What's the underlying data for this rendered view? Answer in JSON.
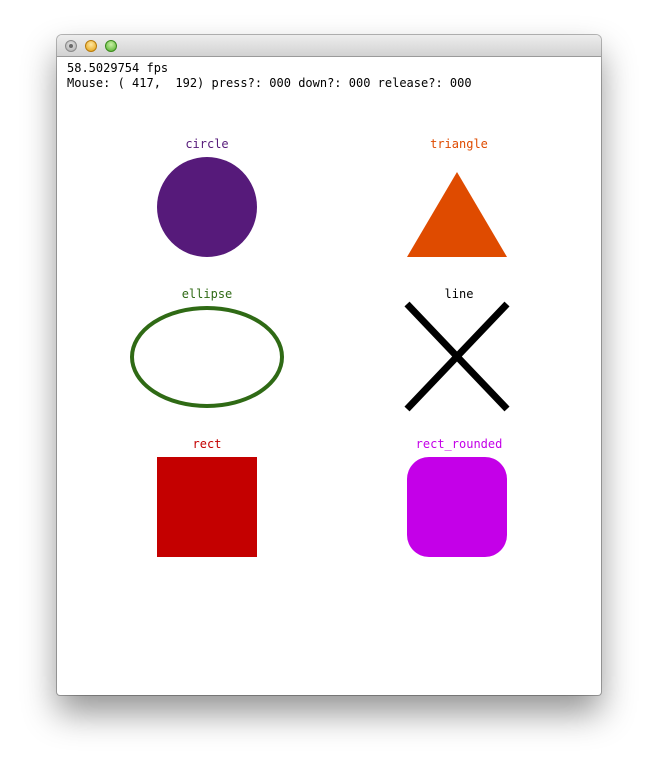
{
  "window": {
    "fps_text": "58.5029754 fps",
    "mouse_text": "Mouse: ( 417,  192) press?: 000 down?: 000 release?: 000"
  },
  "shapes": {
    "circle": {
      "label": "circle",
      "color": "#561a7a"
    },
    "triangle": {
      "label": "triangle",
      "color": "#df4b00"
    },
    "ellipse": {
      "label": "ellipse",
      "color": "#2f6a15"
    },
    "line": {
      "label": "line",
      "color": "#000000"
    },
    "rect": {
      "label": "rect",
      "color": "#c40000"
    },
    "rect_rounded": {
      "label": "rect_rounded",
      "color": "#c400e8"
    }
  }
}
